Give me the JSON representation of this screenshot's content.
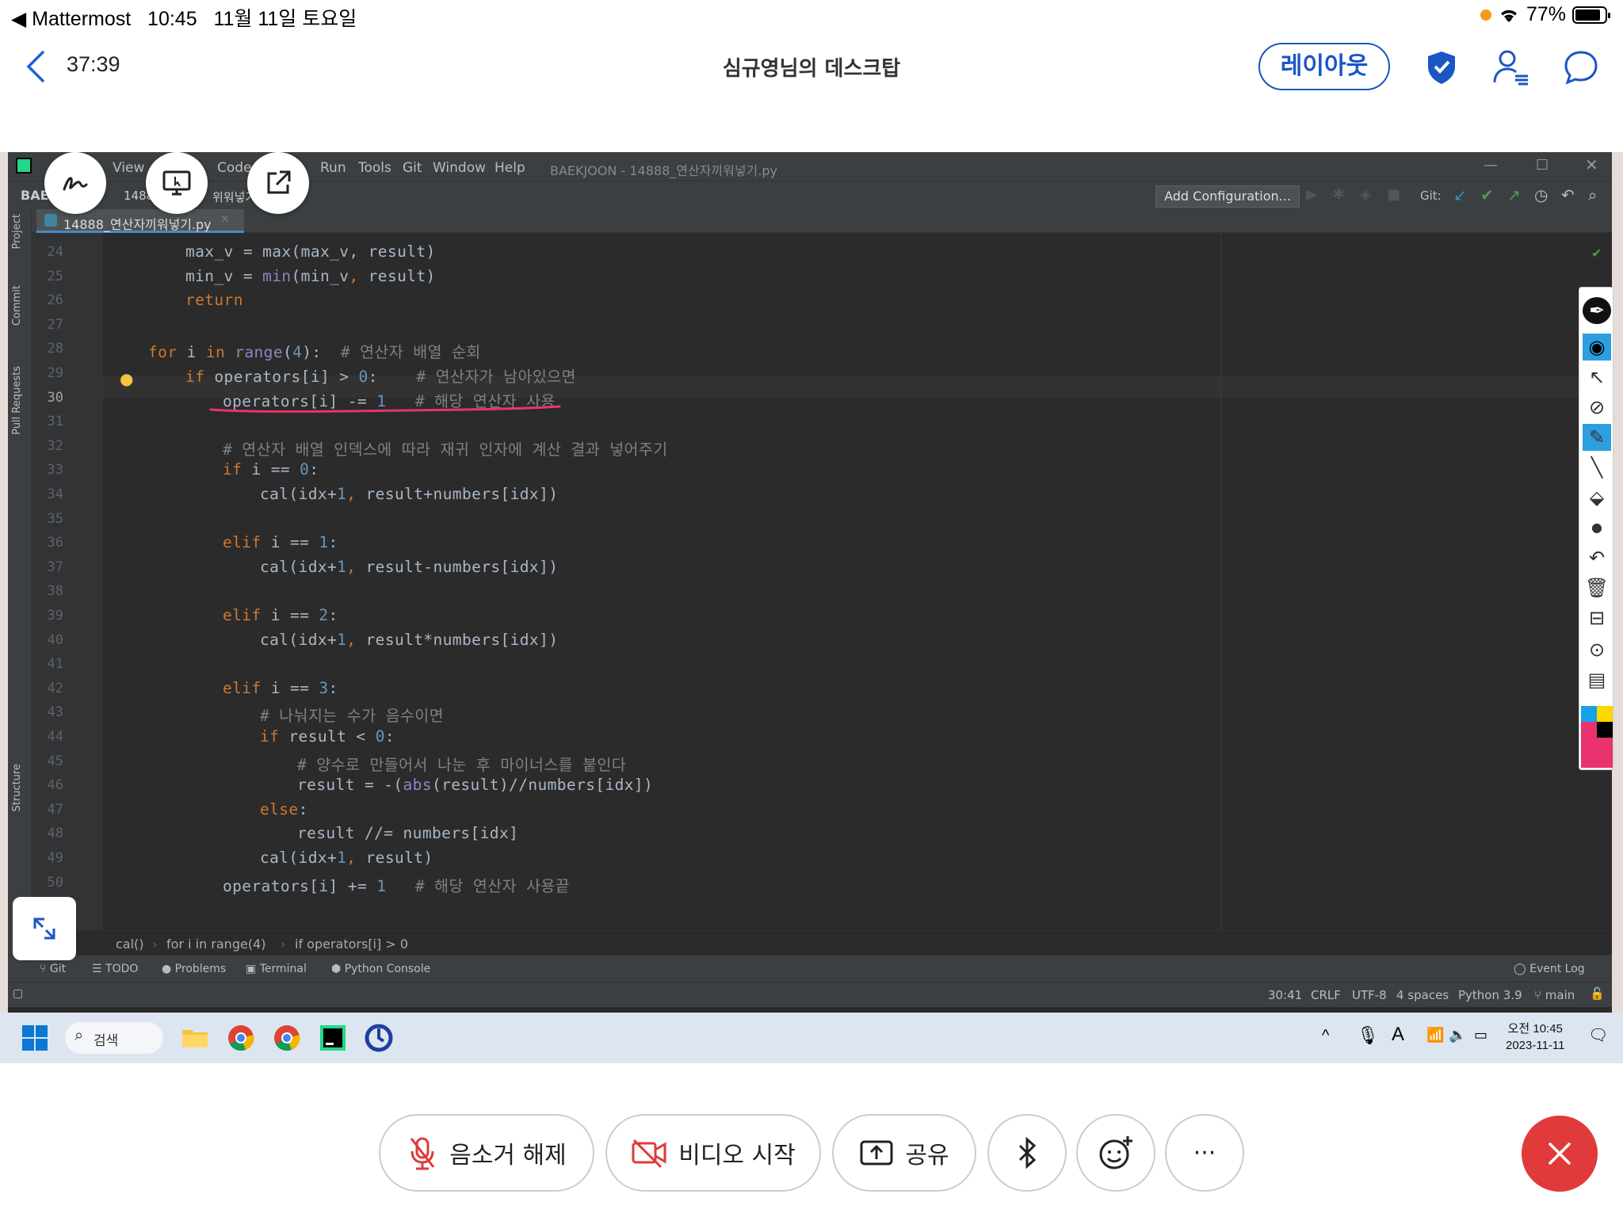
{
  "status_bar": {
    "back_app": "◀ Mattermost",
    "time": "10:45",
    "date": "11월 11일 토요일",
    "battery": "77%"
  },
  "header": {
    "timer": "37:39",
    "title": "심규영님의 데스크탑",
    "layout_button": "레이아웃"
  },
  "ide": {
    "menu": [
      "View",
      "Code",
      "Run",
      "Tools",
      "Git",
      "Window",
      "Help"
    ],
    "window_title": "BAEKJOON - 14888_연산자끼워넣기.py",
    "project_label": "BAE",
    "project_file_partial": "1488",
    "file_partial2": "위워넣기",
    "add_configuration": "Add Configuration...",
    "git_label": "Git:",
    "file_tab": "14888_연산자끼워넣기.py",
    "left_tools": [
      "Project",
      "Commit",
      "Pull Requests",
      "Structure"
    ],
    "line_numbers": [
      "24",
      "25",
      "26",
      "27",
      "28",
      "29",
      "30",
      "31",
      "32",
      "33",
      "34",
      "35",
      "36",
      "37",
      "38",
      "39",
      "40",
      "41",
      "42",
      "43",
      "44",
      "45",
      "46",
      "47",
      "48",
      "49",
      "50"
    ],
    "current_line": "30",
    "code": [
      {
        "indent": 2,
        "parts": [
          {
            "t": "max_v = max(max_v, result)",
            "c": "op"
          }
        ]
      },
      {
        "indent": 2,
        "parts": [
          {
            "t": "min_v = ",
            "c": "op"
          },
          {
            "t": "min",
            "c": "bi"
          },
          {
            "t": "(min_v",
            "c": "op"
          },
          {
            "t": ", ",
            "c": "kw"
          },
          {
            "t": "result)",
            "c": "op"
          }
        ]
      },
      {
        "indent": 2,
        "parts": [
          {
            "t": "return",
            "c": "kw"
          }
        ]
      },
      {
        "indent": 0,
        "parts": []
      },
      {
        "indent": 1,
        "parts": [
          {
            "t": "for ",
            "c": "kw"
          },
          {
            "t": "i ",
            "c": "op"
          },
          {
            "t": "in ",
            "c": "kw"
          },
          {
            "t": "range",
            "c": "bi"
          },
          {
            "t": "(",
            "c": "op"
          },
          {
            "t": "4",
            "c": "num"
          },
          {
            "t": "):  ",
            "c": "op"
          },
          {
            "t": "# 연산자 배열 순회",
            "c": "cm"
          }
        ]
      },
      {
        "indent": 2,
        "parts": [
          {
            "t": "if ",
            "c": "kw"
          },
          {
            "t": "operators[i] > ",
            "c": "op"
          },
          {
            "t": "0",
            "c": "num"
          },
          {
            "t": ":    ",
            "c": "op"
          },
          {
            "t": "# 연산자가 남아있으면",
            "c": "cm"
          }
        ]
      },
      {
        "indent": 3,
        "parts": [
          {
            "t": "operators[i] -= ",
            "c": "op"
          },
          {
            "t": "1",
            "c": "num"
          },
          {
            "t": "   ",
            "c": "op"
          },
          {
            "t": "# 해당 연산자 사용",
            "c": "cm"
          }
        ]
      },
      {
        "indent": 0,
        "parts": []
      },
      {
        "indent": 3,
        "parts": [
          {
            "t": "# 연산자 배열 인덱스에 따라 재귀 인자에 계산 결과 넣어주기",
            "c": "cm"
          }
        ]
      },
      {
        "indent": 3,
        "parts": [
          {
            "t": "if ",
            "c": "kw"
          },
          {
            "t": "i == ",
            "c": "op"
          },
          {
            "t": "0",
            "c": "num"
          },
          {
            "t": ":",
            "c": "op"
          }
        ]
      },
      {
        "indent": 4,
        "parts": [
          {
            "t": "cal(idx+",
            "c": "op"
          },
          {
            "t": "1",
            "c": "num"
          },
          {
            "t": ", ",
            "c": "kw"
          },
          {
            "t": "result+numbers[idx])",
            "c": "op"
          }
        ]
      },
      {
        "indent": 0,
        "parts": []
      },
      {
        "indent": 3,
        "parts": [
          {
            "t": "elif ",
            "c": "kw"
          },
          {
            "t": "i == ",
            "c": "op"
          },
          {
            "t": "1",
            "c": "num"
          },
          {
            "t": ":",
            "c": "op"
          }
        ]
      },
      {
        "indent": 4,
        "parts": [
          {
            "t": "cal(idx+",
            "c": "op"
          },
          {
            "t": "1",
            "c": "num"
          },
          {
            "t": ", ",
            "c": "kw"
          },
          {
            "t": "result-numbers[idx])",
            "c": "op"
          }
        ]
      },
      {
        "indent": 0,
        "parts": []
      },
      {
        "indent": 3,
        "parts": [
          {
            "t": "elif ",
            "c": "kw"
          },
          {
            "t": "i == ",
            "c": "op"
          },
          {
            "t": "2",
            "c": "num"
          },
          {
            "t": ":",
            "c": "op"
          }
        ]
      },
      {
        "indent": 4,
        "parts": [
          {
            "t": "cal(idx+",
            "c": "op"
          },
          {
            "t": "1",
            "c": "num"
          },
          {
            "t": ", ",
            "c": "kw"
          },
          {
            "t": "result*numbers[idx])",
            "c": "op"
          }
        ]
      },
      {
        "indent": 0,
        "parts": []
      },
      {
        "indent": 3,
        "parts": [
          {
            "t": "elif ",
            "c": "kw"
          },
          {
            "t": "i == ",
            "c": "op"
          },
          {
            "t": "3",
            "c": "num"
          },
          {
            "t": ":",
            "c": "op"
          }
        ]
      },
      {
        "indent": 4,
        "parts": [
          {
            "t": "# 나눠지는 수가 음수이면",
            "c": "cm"
          }
        ]
      },
      {
        "indent": 4,
        "parts": [
          {
            "t": "if ",
            "c": "kw"
          },
          {
            "t": "result < ",
            "c": "op"
          },
          {
            "t": "0",
            "c": "num"
          },
          {
            "t": ":",
            "c": "op"
          }
        ]
      },
      {
        "indent": 5,
        "parts": [
          {
            "t": "# 양수로 만들어서 나눈 후 마이너스를 붙인다",
            "c": "cm"
          }
        ]
      },
      {
        "indent": 5,
        "parts": [
          {
            "t": "result = -(",
            "c": "op"
          },
          {
            "t": "abs",
            "c": "bi"
          },
          {
            "t": "(result)//numbers[idx])",
            "c": "op"
          }
        ]
      },
      {
        "indent": 4,
        "parts": [
          {
            "t": "else",
            "c": "kw"
          },
          {
            "t": ":",
            "c": "op"
          }
        ]
      },
      {
        "indent": 5,
        "parts": [
          {
            "t": "result //= numbers[idx]",
            "c": "op"
          }
        ]
      },
      {
        "indent": 4,
        "parts": [
          {
            "t": "cal(idx+",
            "c": "op"
          },
          {
            "t": "1",
            "c": "num"
          },
          {
            "t": ", ",
            "c": "kw"
          },
          {
            "t": "result)",
            "c": "op"
          }
        ]
      },
      {
        "indent": 3,
        "parts": [
          {
            "t": "operators[i] += ",
            "c": "op"
          },
          {
            "t": "1",
            "c": "num"
          },
          {
            "t": "   ",
            "c": "op"
          },
          {
            "t": "# 해당 연산자 사용끝",
            "c": "cm"
          }
        ]
      }
    ],
    "breadcrumb": [
      "cal()",
      "for i in range(4)",
      "if operators[i] > 0"
    ],
    "bottom_tools": [
      "Git",
      "TODO",
      "Problems",
      "Terminal",
      "Python Console"
    ],
    "event_log": "Event Log",
    "status": {
      "position": "30:41",
      "line_sep": "CRLF",
      "encoding": "UTF-8",
      "indent": "4 spaces",
      "interpreter": "Python 3.9",
      "branch": "main"
    },
    "annotation_color": "#e8336f"
  },
  "taskbar": {
    "search": "검색",
    "clock_time": "오전 10:45",
    "clock_date": "2023-11-11"
  },
  "controls": {
    "unmute": "음소거 해제",
    "start_video": "비디오 시작",
    "share": "공유",
    "more": "···"
  },
  "colors": {
    "accent": "#1a56c4",
    "end": "#e03a3a"
  }
}
